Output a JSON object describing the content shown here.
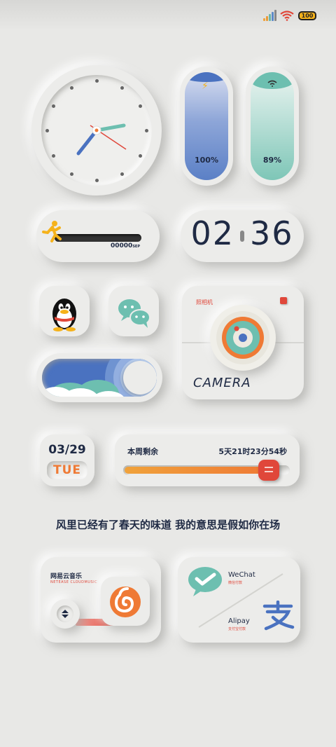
{
  "status": {
    "battery": "100"
  },
  "pills": [
    {
      "percent": "100%",
      "icon": "lightning-icon"
    },
    {
      "percent": "89%",
      "icon": "wifi-icon"
    }
  ],
  "run": {
    "counter": "00000",
    "unit": "SEP",
    "progress": 0
  },
  "clock": {
    "hour": "02",
    "minute": "36"
  },
  "apps": {
    "qq": "qq-penguin-icon",
    "wechat": "wechat-bubbles-icon"
  },
  "camera": {
    "tag": "照相机",
    "label": "CAMERA"
  },
  "date": {
    "day": "03/29",
    "weekday": "TUE"
  },
  "week": {
    "label": "本周剩余",
    "remaining": "5天21时23分54秒",
    "progress": 0.87
  },
  "quote": "风里已经有了春天的味道  我的意思是假如你在场",
  "music": {
    "title": "网易云音乐",
    "subtitle_a": "NETEASE",
    "subtitle_b": "CLOUDMUSIC"
  },
  "pay": {
    "wechat": "WeChat",
    "wechat_sub": "微信付款",
    "alipay": "Alipay",
    "alipay_sub": "支付宝付款"
  },
  "colors": {
    "accent_orange": "#ef7a35",
    "accent_red": "#e0473a",
    "navy": "#1f2a44",
    "teal": "#6dbfb0",
    "blue": "#4a72c0"
  }
}
